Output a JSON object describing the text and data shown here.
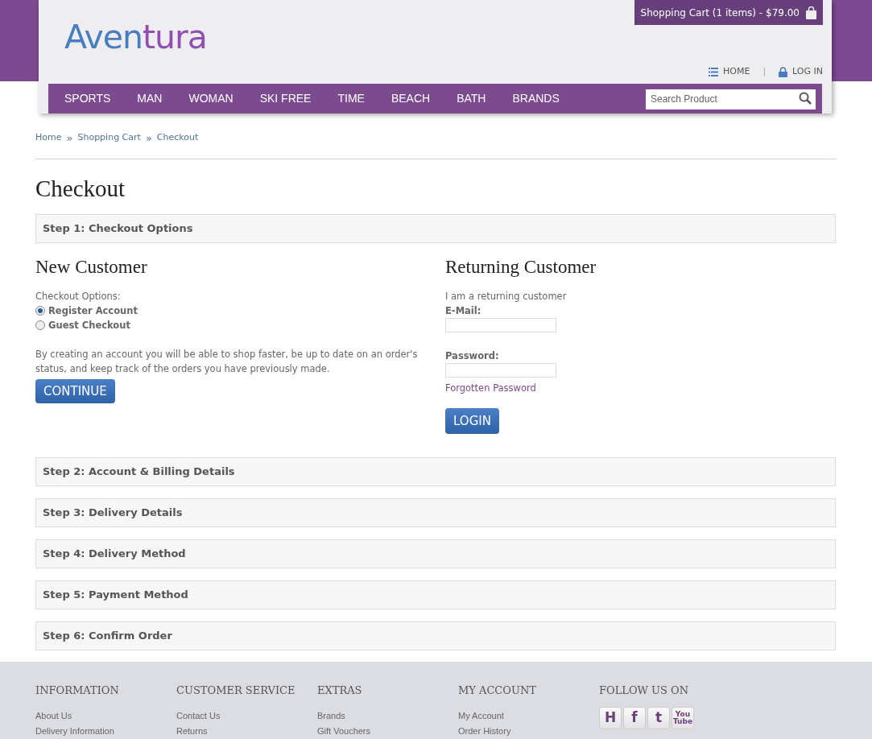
{
  "header": {
    "logo": {
      "first": "Aven",
      "second": "tura"
    },
    "cart": "Shopping Cart (1 items) - $79.00",
    "links": [
      {
        "kind": "home",
        "label": "HOME"
      },
      {
        "kind": "login",
        "label": "LOG IN"
      }
    ],
    "separator": "|"
  },
  "nav": {
    "items": [
      "SPORTS",
      "MAN",
      "WOMAN",
      "SKI FREE",
      "TIME",
      "BEACH",
      "BATH",
      "BRANDS"
    ],
    "search": {
      "placeholder": "Search Product"
    }
  },
  "breadcrumb": {
    "items": [
      "Home",
      "Shopping Cart",
      "Checkout"
    ],
    "separator": "»"
  },
  "title": "Checkout",
  "steps": [
    {
      "label": "Step 1: Checkout Options"
    },
    {
      "label": "Step 2: Account & Billing Details"
    },
    {
      "label": "Step 3: Delivery Details"
    },
    {
      "label": "Step 4: Delivery Method"
    },
    {
      "label": "Step 5: Payment Method"
    },
    {
      "label": "Step 6: Confirm Order"
    }
  ],
  "new_customer": {
    "heading": "New Customer",
    "options_label": "Checkout Options:",
    "options": [
      {
        "label": "Register Account",
        "selected": true
      },
      {
        "label": "Guest Checkout",
        "selected": false
      }
    ],
    "description": "By creating an account you will be able to shop faster, be up to date on an order's status, and keep track of the orders you have previously made.",
    "button": "CONTINUE"
  },
  "returning_customer": {
    "heading": "Returning Customer",
    "intro": "I am a returning customer",
    "email_label": "E-Mail:",
    "password_label": "Password:",
    "forgot": "Forgotten Password",
    "button": "LOGIN"
  },
  "footer": {
    "columns": [
      {
        "heading": "INFORMATION",
        "links": [
          "About Us",
          "Delivery Information"
        ]
      },
      {
        "heading": "CUSTOMER SERVICE",
        "links": [
          "Contact Us",
          "Returns"
        ]
      },
      {
        "heading": "EXTRAS",
        "links": [
          "Brands",
          "Gift Vouchers"
        ]
      },
      {
        "heading": "MY ACCOUNT",
        "links": [
          "My Account",
          "Order History"
        ]
      }
    ],
    "follow": {
      "heading": "FOLLOW US ON",
      "icons": [
        {
          "kind": "h",
          "label": "H"
        },
        {
          "kind": "facebook",
          "label": "f"
        },
        {
          "kind": "twitter",
          "label": "t"
        },
        {
          "kind": "youtube",
          "label": "You Tube"
        }
      ]
    }
  }
}
